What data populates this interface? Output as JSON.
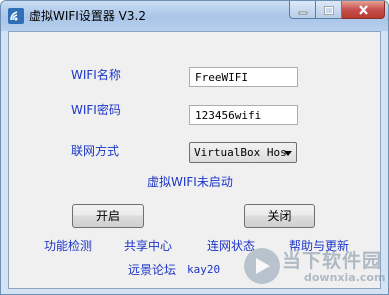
{
  "window": {
    "title": "虚拟WIFI设置器 V3.2",
    "icons": {
      "app": "wifi-signal-icon",
      "minimize": "minimize-icon",
      "maximize": "maximize-icon",
      "close": "close-icon"
    }
  },
  "form": {
    "wifi_name_label": "WIFI名称",
    "wifi_name_value": "FreeWIFI",
    "wifi_password_label": "WIFI密码",
    "wifi_password_value": "123456wifi",
    "network_label": "联网方式",
    "network_selected": "VirtualBox Hos"
  },
  "status": {
    "text": "虚拟WIFI未启动"
  },
  "buttons": {
    "start": "开启",
    "close": "关闭"
  },
  "links": {
    "feature_check": "功能检测",
    "sharing_center": "共享中心",
    "network_status": "连网状态",
    "help_update": "帮助与更新",
    "yuanjing_forum": "远景论坛",
    "author": "kay20"
  },
  "watermark": {
    "cn": "当下软件园",
    "en": "downxia.com"
  },
  "colors": {
    "label": "#1d36c8",
    "titlebar": "#a9c5e8",
    "close_button": "#c75050"
  }
}
